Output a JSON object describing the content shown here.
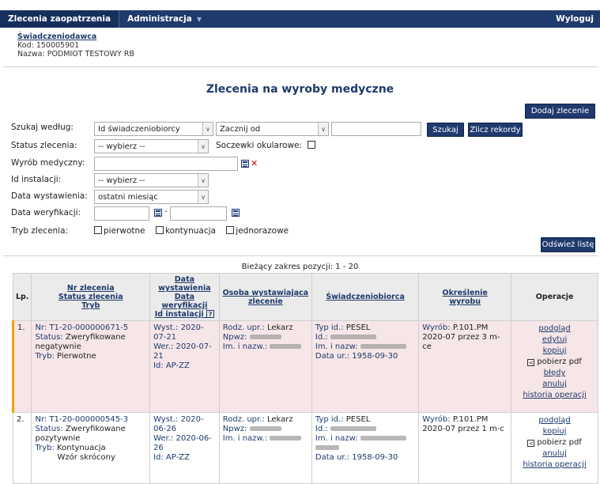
{
  "topbar": {
    "menu_orders": "Zlecenia zaopatrzenia",
    "menu_admin": "Administracja",
    "logout": "Wyloguj"
  },
  "provider": {
    "link": "Świadczeniodawca",
    "code": "Kod: 150005901",
    "name": "Nazwa: PODMIOT TESTOWY RB"
  },
  "page": {
    "title": "Zlecenia na wyroby medyczne"
  },
  "buttons": {
    "add": "Dodaj zlecenie",
    "search": "Szukaj",
    "count": "Zlicz rekordy",
    "refresh": "Odśwież listę"
  },
  "filters": {
    "search_by_label": "Szukaj według:",
    "search_by_value": "Id świadczeniobiorcy",
    "search_mode_value": "Zacznij od",
    "search_text_value": "",
    "status_label": "Status zlecenia:",
    "status_value": "-- wybierz --",
    "glasses_label": "Soczewki okularowe:",
    "device_label": "Wyrób medyczny:",
    "install_label": "Id instalacji:",
    "install_value": "-- wybierz --",
    "issue_date_label": "Data wystawienia:",
    "issue_date_value": "ostatni miesiąc",
    "verify_date_label": "Data weryfikacji:",
    "verify_sep": "-",
    "mode_label": "Tryb zlecenia:",
    "mode_primary": "pierwotne",
    "mode_continue": "kontynuacja",
    "mode_single": "jednorazowe"
  },
  "range_text": "Bieżący zakres pozycji: 1 - 20",
  "table": {
    "headers": {
      "lp": "Lp.",
      "nr_1": "Nr zlecenia",
      "nr_2": "Status zlecenia",
      "nr_3": "Tryb",
      "date_1": "Data wystawienia",
      "date_2": "Data weryfikacji",
      "date_3": "Id instalacji",
      "date_help": "?",
      "person_1": "Osoba wystawiająca",
      "person_2": "zlecenie",
      "recipient": "Świadczeniobiorca",
      "product_1": "Określenie",
      "product_2": "wyrobu",
      "ops": "Operacje"
    },
    "rows": [
      {
        "lp": "1.",
        "nr_key": "Nr:",
        "nr": "T1-20-000000671-5",
        "status_key": "Status:",
        "status": "Zweryfikowane negatywnie",
        "mode_key": "Tryb:",
        "mode": "Pierwotne",
        "wyst_key": "Wyst.:",
        "wyst": "2020-07-21",
        "wer_key": "Wer.:",
        "wer": "2020-07-21",
        "id_key": "Id:",
        "id": "AP-ZZ",
        "rodz_key": "Rodz. upr.:",
        "rodz": "Lekarz",
        "npwz_key": "Npwz:",
        "imn_key": "Im. i nazw.:",
        "typ_key": "Typ id.:",
        "typ": "PESEL",
        "rid_key": "Id.:",
        "rname_key": "Im. i nazw:",
        "dob_key": "Data ur.:",
        "dob": "1958-09-30",
        "product_key": "Wyrób:",
        "product": "P.101.PM",
        "product_desc": "2020-07 przez 3 m-ce",
        "ops": [
          "podgląd",
          "edytuj",
          "kopiuj",
          "pobierz pdf",
          "błędy",
          "anuluj",
          "historia operacji"
        ]
      },
      {
        "lp": "2.",
        "nr_key": "Nr:",
        "nr": "T1-20-000000545-3",
        "status_key": "Status:",
        "status": "Zweryfikowane pozytywnie",
        "mode_key": "Tryb:",
        "mode": "Kontynuacja",
        "mode_extra": "Wzór skrócony",
        "wyst_key": "Wyst.:",
        "wyst": "2020-06-26",
        "wer_key": "Wer.:",
        "wer": "2020-06-26",
        "id_key": "Id:",
        "id": "AP-ZZ",
        "rodz_key": "Rodz. upr.:",
        "rodz": "Lekarz",
        "npwz_key": "Npwz:",
        "imn_key": "Im. i nazw.:",
        "typ_key": "Typ id.:",
        "typ": "PESEL",
        "rid_key": "Id.:",
        "rname_key": "Im. i nazw:",
        "dob_key": "Data ur.:",
        "dob": "1958-09-30",
        "product_key": "Wyrób:",
        "product": "P.101.PM",
        "product_desc": "2020-07 przez 1 m-c",
        "ops": [
          "podgląd",
          "kopiuj",
          "pobierz pdf",
          "anuluj",
          "historia operacji"
        ]
      }
    ]
  },
  "colors": {
    "navy": "#1f3a6d",
    "row_highlight": "#f6e6e7",
    "accent": "#f0a500"
  }
}
